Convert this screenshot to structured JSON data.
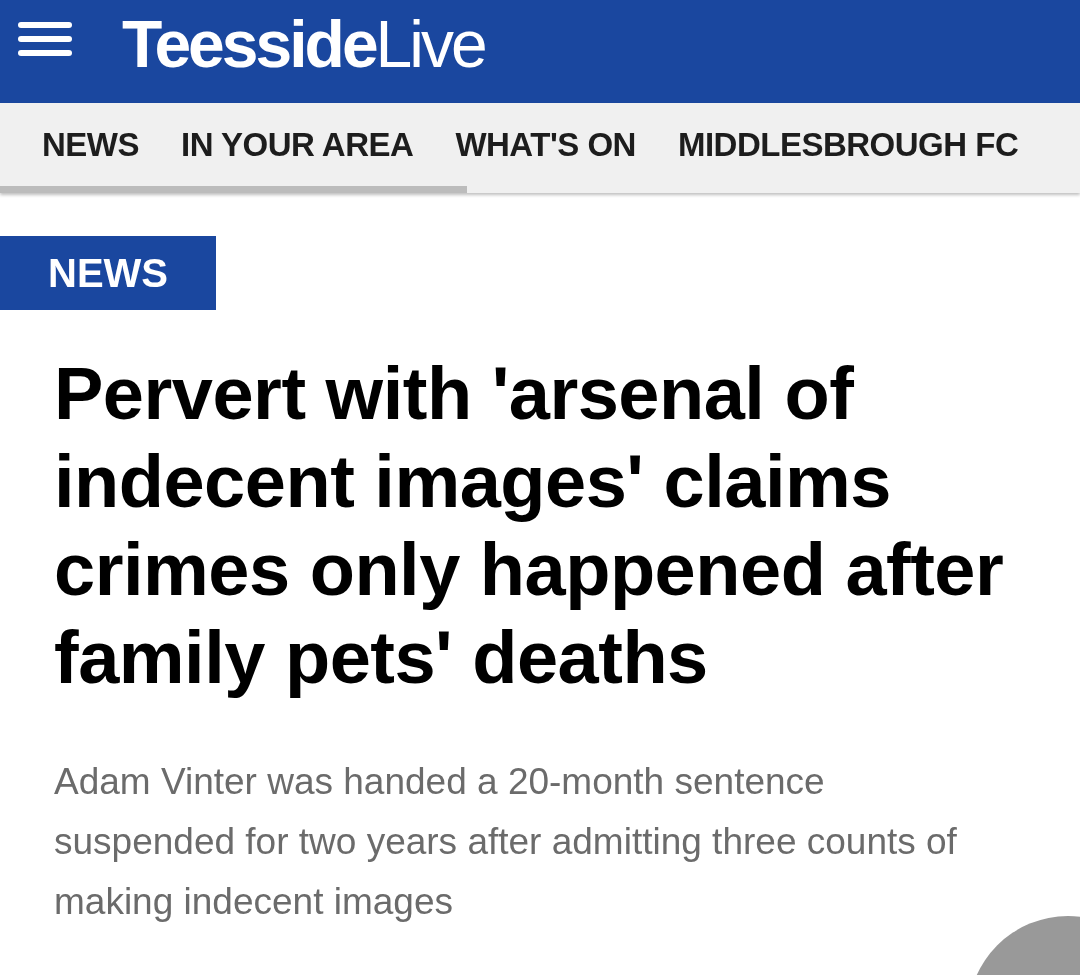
{
  "header": {
    "logo": "**Teesside**Live"
  },
  "nav": {
    "items": [
      {
        "label": "NEWS"
      },
      {
        "label": "IN YOUR AREA"
      },
      {
        "label": "WHAT'S ON"
      },
      {
        "label": "MIDDLESBROUGH FC"
      }
    ]
  },
  "article": {
    "section": "NEWS",
    "headline": "Pervert with 'arsenal of indecent images' claims crimes only happened after family pets' deaths",
    "standfirst": "Adam Vinter was handed a 20-month sentence suspended for two years after admitting three counts of making indecent images"
  }
}
